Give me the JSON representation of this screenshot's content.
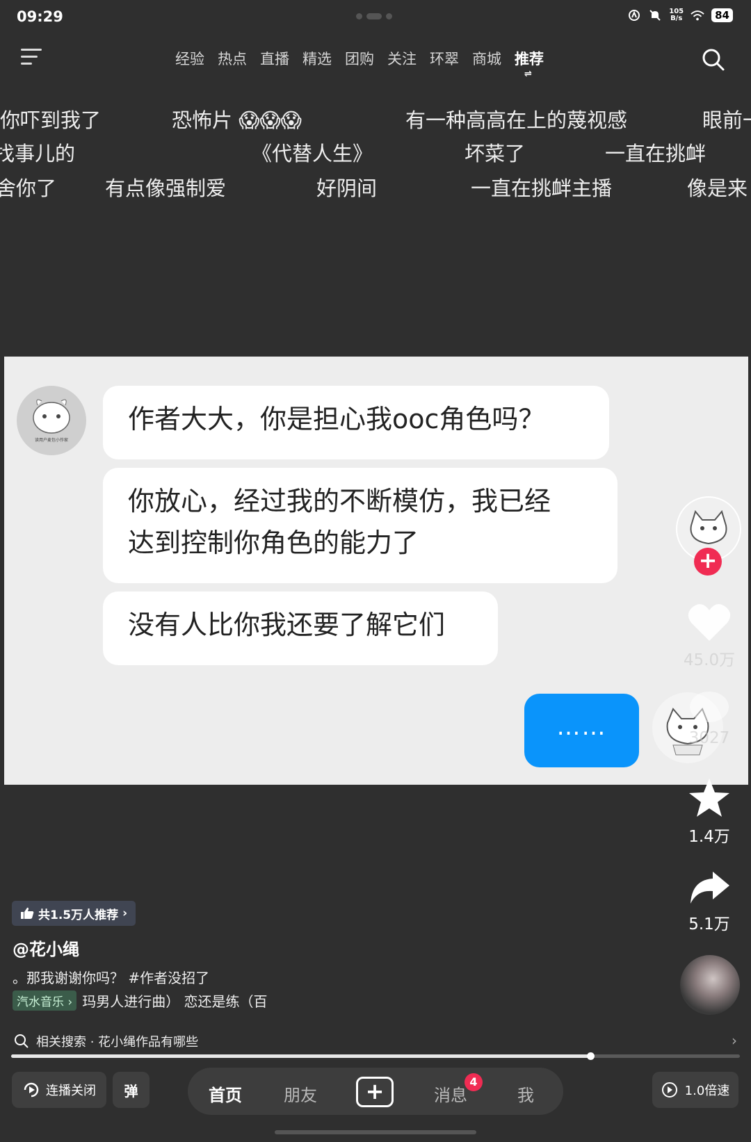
{
  "status": {
    "time": "09:29",
    "net_speed_top": "105",
    "net_speed_bottom": "B/s",
    "battery": "84"
  },
  "nav": {
    "tabs": [
      {
        "label": "经验"
      },
      {
        "label": "热点"
      },
      {
        "label": "直播"
      },
      {
        "label": "精选"
      },
      {
        "label": "团购"
      },
      {
        "label": "关注"
      },
      {
        "label": "环翠"
      },
      {
        "label": "商城"
      },
      {
        "label": "推荐"
      }
    ],
    "swap_glyph": "⇌"
  },
  "danmaku": {
    "row1": [
      "你吓到我了",
      "恐怖片 😱😱😱",
      "有一种高高在上的蔑视感",
      "眼前一"
    ],
    "row2": [
      "找事儿的",
      "《代替人生》",
      "坏菜了",
      "一直在挑衅"
    ],
    "row3": [
      "舍你了",
      "有点像强制爱",
      "好阴间",
      "一直在挑衅主播",
      "像是来"
    ]
  },
  "video": {
    "bubble1": "作者大大，你是担心我ooc角色吗？",
    "bubble2_line1": "你放心，经过我的不断模仿，我已经",
    "bubble2_line2": "达到控制你角色的能力了",
    "bubble3": "没有人比你我还要了解它们",
    "my_bubble": "……",
    "avatar_caption": "读用户麦包小作家"
  },
  "rail": {
    "likes": "45.0万",
    "comments": "3027",
    "favorites": "1.4万",
    "shares": "5.1万"
  },
  "info": {
    "recommend": "共1.5万人推荐",
    "author": "@花小绳",
    "caption": "。那我谢谢你吗？ #作者没招了",
    "music_tag": "汽水音乐",
    "music_title": "玛男人进行曲）  恋还是练（百"
  },
  "related": {
    "label": "相关搜索 · 花小绳作品有哪些"
  },
  "progress": {
    "played_fraction": 0.795
  },
  "bottom": {
    "autoplay": "连播关闭",
    "danmaku_btn": "弹",
    "home": "首页",
    "friends": "朋友",
    "messages": "消息",
    "messages_badge": "4",
    "me": "我",
    "speed": "1.0倍速"
  },
  "colors": {
    "accent_blue": "#0a94fb",
    "accent_red": "#f02c53"
  }
}
